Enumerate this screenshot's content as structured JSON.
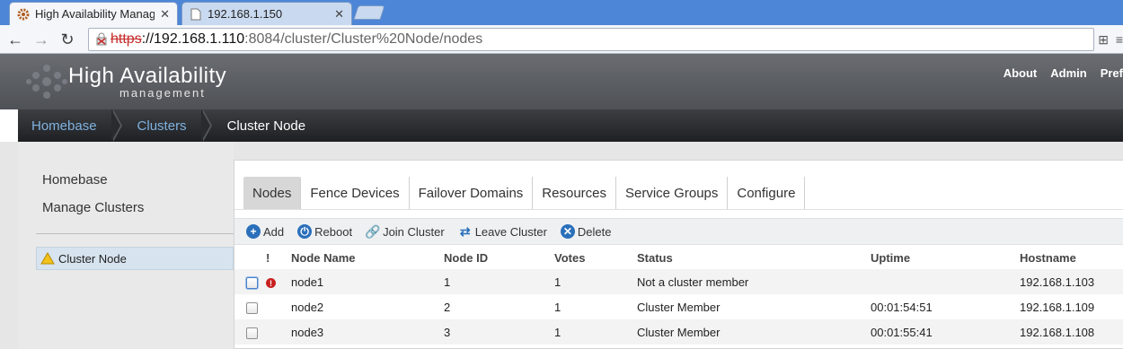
{
  "browser": {
    "tabs": [
      {
        "title": "High Availability Manag",
        "active": true
      },
      {
        "title": "192.168.1.150",
        "active": false
      }
    ],
    "url": {
      "scheme": "https",
      "host": "://192.168.1.110",
      "rest": ":8084/cluster/Cluster%20Node/nodes"
    }
  },
  "header": {
    "title": "High Availability",
    "subtitle": "management",
    "links": [
      "About",
      "Admin",
      "Pref"
    ]
  },
  "breadcrumb": [
    "Homebase",
    "Clusters",
    "Cluster Node"
  ],
  "sidebar": {
    "links": [
      "Homebase",
      "Manage Clusters"
    ],
    "node": "Cluster Node"
  },
  "tabs": [
    "Nodes",
    "Fence Devices",
    "Failover Domains",
    "Resources",
    "Service Groups",
    "Configure"
  ],
  "actions": [
    "Add",
    "Reboot",
    "Join Cluster",
    "Leave Cluster",
    "Delete"
  ],
  "table": {
    "headers": [
      "!",
      "Node Name",
      "Node ID",
      "Votes",
      "Status",
      "Uptime",
      "Hostname"
    ],
    "rows": [
      {
        "name": "node1",
        "id": "1",
        "votes": "1",
        "status": "Not a cluster member",
        "uptime": "",
        "hostname": "192.168.1.103"
      },
      {
        "name": "node2",
        "id": "2",
        "votes": "1",
        "status": "Cluster Member",
        "uptime": "00:01:54:51",
        "hostname": "192.168.1.109"
      },
      {
        "name": "node3",
        "id": "3",
        "votes": "1",
        "status": "Cluster Member",
        "uptime": "00:01:55:41",
        "hostname": "192.168.1.108"
      }
    ]
  },
  "colors": {
    "accent_link": "#7fb2e0",
    "error": "#c92020",
    "action_icon": "#2a6fba"
  }
}
